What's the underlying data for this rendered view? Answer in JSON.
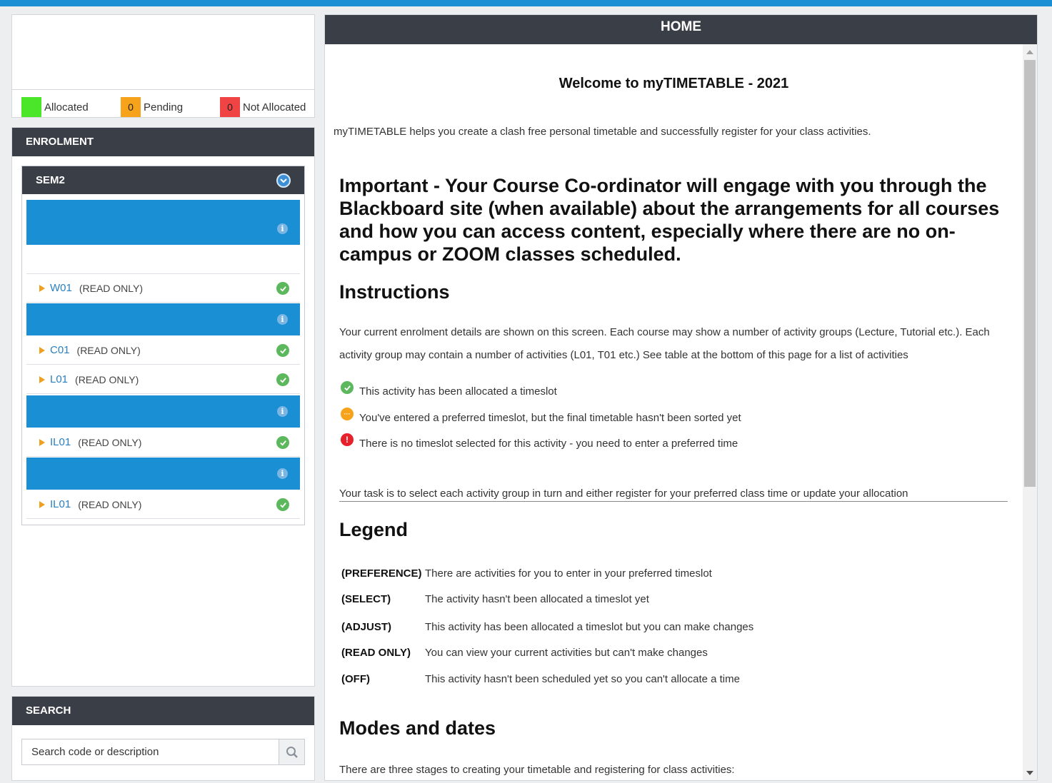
{
  "colors": {
    "accent": "#1a8fd4",
    "header_bg": "#3a3f47",
    "allocated": "#4be52a",
    "pending": "#f7a21b",
    "not_allocated": "#f04444",
    "ok": "#5cb85c"
  },
  "legend": {
    "allocated_label": "Allocated",
    "pending_count": "0",
    "pending_label": "Pending",
    "not_allocated_count": "0",
    "not_allocated_label": "Not Allocated"
  },
  "enrolment": {
    "title": "ENROLMENT",
    "semester": "SEM2",
    "activities": [
      {
        "code": "W01",
        "mode": "(READ ONLY)"
      },
      {
        "code": "C01",
        "mode": "(READ ONLY)"
      },
      {
        "code": "L01",
        "mode": "(READ ONLY)"
      },
      {
        "code": "IL01",
        "mode": "(READ ONLY)"
      },
      {
        "code": "IL01",
        "mode": "(READ ONLY)"
      }
    ]
  },
  "search": {
    "title": "SEARCH",
    "placeholder": "Search code or description"
  },
  "home": {
    "title": "HOME",
    "welcome": "Welcome to myTIMETABLE - 2021",
    "intro": "myTIMETABLE helps you create a clash free personal timetable and successfully register for your class activities.",
    "important": "Important - Your Course Co-ordinator will engage with you through the Blackboard site (when available) about the arrangements for all courses and how you can access content, especially where there are no on-campus or ZOOM classes scheduled.",
    "instructions_heading": "Instructions",
    "instructions_text": "Your current enrolment details are shown on this screen. Each course may show a number of activity groups (Lecture, Tutorial etc.). Each activity group may contain a number of activities (L01, T01 etc.) See table at the bottom of this page for a list of activities",
    "status_allocated": "This activity has been allocated a timeslot",
    "status_pending": "You've entered a preferred timeslot, but the final timetable hasn't been sorted yet",
    "status_none": "There is no timeslot selected for this activity - you need to enter a preferred time",
    "task": "Your task is to select each activity group in turn and either register for your preferred class time or update your allocation",
    "legend_heading": "Legend",
    "legend": [
      {
        "key": "(PREFERENCE)",
        "desc": "There are activities for you to enter in your preferred timeslot"
      },
      {
        "key": "(SELECT)",
        "desc": "The activity hasn't been allocated a timeslot yet"
      },
      {
        "key": "(ADJUST)",
        "desc": "This activity has been allocated a timeslot but you can make changes"
      },
      {
        "key": "(READ ONLY)",
        "desc": "You can view your current activities but can't make changes"
      },
      {
        "key": "(OFF)",
        "desc": "This activity hasn't been scheduled yet so you can't allocate a time"
      }
    ],
    "modes_heading": "Modes and dates",
    "modes_text": "There are three stages to creating your timetable and registering for class activities:"
  }
}
